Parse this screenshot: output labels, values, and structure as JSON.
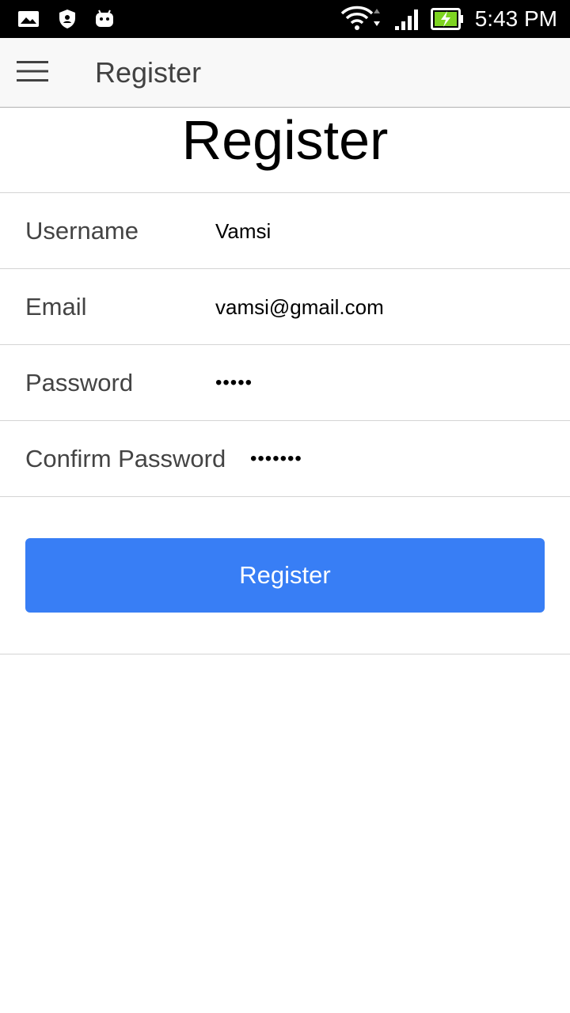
{
  "status_bar": {
    "time": "5:43 PM",
    "icons": [
      "gallery-icon",
      "shield-icon",
      "android-icon",
      "wifi-icon",
      "signal-icon",
      "battery-charging-icon"
    ]
  },
  "app_bar": {
    "title": "Register",
    "menu_icon": "hamburger-menu-icon"
  },
  "page": {
    "heading": "Register"
  },
  "form": {
    "fields": [
      {
        "label": "Username",
        "value": "Vamsi"
      },
      {
        "label": "Email",
        "value": "vamsi@gmail.com"
      },
      {
        "label": "Password",
        "value": "•••••"
      },
      {
        "label": "Confirm Password",
        "value": "•••••••"
      }
    ],
    "submit_label": "Register"
  },
  "colors": {
    "primary": "#387ef5",
    "status_bar": "#000000",
    "app_bar": "#f8f8f8"
  }
}
